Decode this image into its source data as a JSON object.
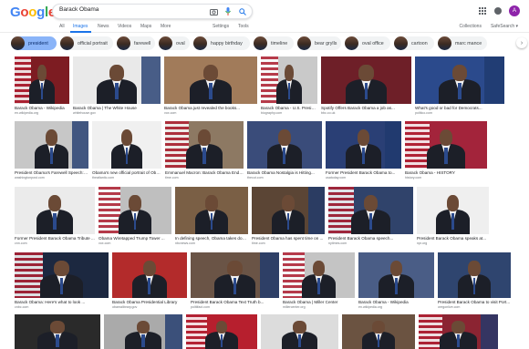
{
  "logo": {
    "letters": [
      "G",
      "o",
      "o",
      "g",
      "l",
      "e"
    ],
    "colors": [
      "#4285f4",
      "#ea4335",
      "#fbbc05",
      "#4285f4",
      "#34a853",
      "#ea4335"
    ]
  },
  "search": {
    "query": "Barack Obama"
  },
  "header_right": {
    "avatar_letter": "A"
  },
  "tabs": {
    "items": [
      "All",
      "Images",
      "News",
      "Videos",
      "Maps",
      "More"
    ],
    "active": "Images",
    "settings": "Settings",
    "tools": "Tools",
    "collections": "Collections",
    "safesearch": "SafeSearch ▾"
  },
  "chips": [
    "president",
    "official portrait",
    "farewell",
    "oval",
    "happy birthday",
    "timeline",
    "bear grylls",
    "oval office",
    "cartoon",
    "marc mance"
  ],
  "rows": [
    {
      "items": [
        {
          "caption": "Barack Obama - Wikipedia",
          "source": "en.wikipedia.org",
          "bg": "#7d1c22"
        },
        {
          "caption": "Barack Obama | The White House",
          "source": "whitehouse.gov",
          "bg": "#e9e9e9"
        },
        {
          "caption": "Barack Obama just revealed the books...",
          "source": "vox.com",
          "bg": "#a17b5a"
        },
        {
          "caption": "Barack Obama - U.S. Presiden...",
          "source": "biography.com",
          "bg": "#c9c9c9"
        },
        {
          "caption": "Spotify Offers Barack Obama a job as...",
          "source": "bbc.co.uk",
          "bg": "#6e1f28"
        },
        {
          "caption": "What's good or bad for Democrats...",
          "source": "politico.com",
          "bg": "#2b4a8c"
        }
      ]
    },
    {
      "items": [
        {
          "caption": "President Obama's Farewell Speech: W...",
          "source": "washingtonpost.com",
          "bg": "#c7c7c7"
        },
        {
          "caption": "Obama's new official portrait of Obama ...",
          "source": "theatlantic.com",
          "bg": "#f0f0f0"
        },
        {
          "caption": "Emmanuel Macron: Barack Obama Endor...",
          "source": "time.com",
          "bg": "#8d7963"
        },
        {
          "caption": "Barack Obama Nostalgia is Hitting...",
          "source": "thecut.com",
          "bg": "#3a4c7a"
        },
        {
          "caption": "Former President Barack Obama to...",
          "source": "usatoday.com",
          "bg": "#2a3f75"
        },
        {
          "caption": "Barack Obama - HISTORY",
          "source": "history.com",
          "bg": "#a3243b"
        }
      ]
    },
    {
      "items": [
        {
          "caption": "Former President Barack Obama Tribute ...",
          "source": "cnn.com",
          "bg": "#ebebeb"
        },
        {
          "caption": "Obama Wiretapped Trump Tower ...",
          "source": "vox.com",
          "bg": "#bfbfbf"
        },
        {
          "caption": "In defining speech, Obama takes down ...",
          "source": "nbcnews.com",
          "bg": "#7a5f45"
        },
        {
          "caption": "President Obama has spent time on ...",
          "source": "time.com",
          "bg": "#5b4535"
        },
        {
          "caption": "President Barack Obama speech...",
          "source": "nytimes.com",
          "bg": "#30436b"
        },
        {
          "caption": "President Barack Obama speaks at...",
          "source": "npr.org",
          "bg": "#efefef"
        }
      ]
    },
    {
      "items": [
        {
          "caption": "Barack Obama: Here's what to look ...",
          "source": "cnbc.com",
          "bg": "#1c2840"
        },
        {
          "caption": "Barack Obama Presidential Library",
          "source": "obamalibrary.gov",
          "bg": "#b32b2b"
        },
        {
          "caption": "President Barack Obama Text Truth b...",
          "source": "politifact.com",
          "bg": "#6a5446"
        },
        {
          "caption": "Barack Obama | Miller Center",
          "source": "millercenter.org",
          "bg": "#c4c4c4"
        },
        {
          "caption": "Barack Obama - Wikipedia",
          "source": "en.wikipedia.org",
          "bg": "#4a5d86"
        },
        {
          "caption": "President Barack Obama to visit Port...",
          "source": "oregonlive.com",
          "bg": "#2f456f"
        }
      ]
    },
    {
      "items": [
        {
          "caption": "",
          "source": "",
          "bg": "#2a2a2a"
        },
        {
          "caption": "",
          "source": "",
          "bg": "#aaaaaa"
        },
        {
          "caption": "",
          "source": "",
          "bg": "#b71f2e"
        },
        {
          "caption": "",
          "source": "",
          "bg": "#dcdcdc"
        },
        {
          "caption": "",
          "source": "",
          "bg": "#6b5341"
        },
        {
          "caption": "",
          "source": "",
          "bg": "#8b2432"
        }
      ]
    }
  ]
}
